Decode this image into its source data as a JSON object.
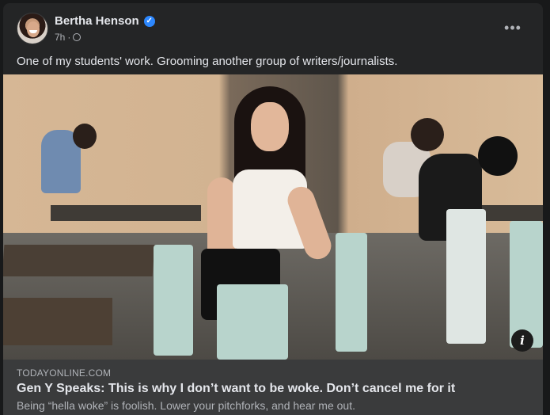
{
  "post": {
    "author": "Bertha Henson",
    "time": "7h",
    "separator": "·",
    "privacy_icon": "globe-icon",
    "more_icon": "more-options-icon",
    "more_glyph": "•••",
    "caption": "One of my students' work. Grooming another group of writers/journalists."
  },
  "link_preview": {
    "domain": "TODAYONLINE.COM",
    "title": "Gen Y Speaks: This is why I don’t want to be woke. Don’t cancel me for it",
    "subtitle": "Being “hella woke” is foolish. Lower your pitchforks, and hear me out.",
    "info_glyph": "i"
  },
  "colors": {
    "background": "#18191a",
    "card": "#242526",
    "link_box": "#3a3b3c",
    "verified": "#2d88ff",
    "primary_text": "#e4e6eb",
    "secondary_text": "#b0b3b8"
  }
}
